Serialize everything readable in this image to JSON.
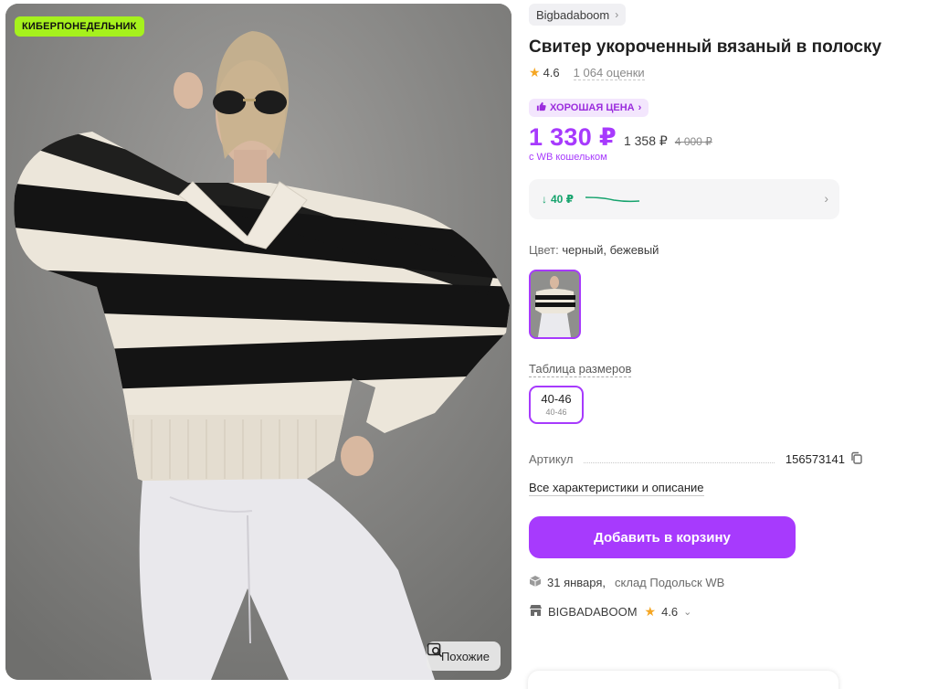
{
  "gallery": {
    "promo_badge": "КИБЕРПОНЕДЕЛЬНИК",
    "similar_label": "Похожие"
  },
  "product": {
    "brand": "Bigbadaboom",
    "title": "Свитер укороченный вязаный в полоску",
    "rating": "4.6",
    "reviews": "1 064 оценки",
    "good_price_label": "ХОРОШАЯ ЦЕНА",
    "price_main": "1 330 ₽",
    "price_mid": "1 358 ₽",
    "price_old": "4 000 ₽",
    "wallet_note": "с WB кошельком",
    "price_drop": "40 ₽",
    "color_key": "Цвет:",
    "color_value": "черный, бежевый",
    "size_table_link": "Таблица размеров",
    "sizes": [
      {
        "label": "40-46",
        "sub": "40-46"
      }
    ],
    "article_label": "Артикул",
    "article_value": "156573141",
    "all_specs_link": "Все характеристики и описание",
    "add_to_cart": "Добавить в корзину",
    "delivery_date": "31 января,",
    "warehouse": "склад Подольск WB",
    "seller_name": "BIGBADABOOM",
    "seller_rating": "4.6"
  },
  "colors": {
    "accent": "#a73afd",
    "promo": "#a6f11d",
    "price_down": "#16a36d",
    "star": "#f5a623"
  },
  "icons": [
    "search-image-icon",
    "star-icon",
    "thumbs-up-icon",
    "arrow-down-icon",
    "chevron-right-icon",
    "copy-icon",
    "box-icon",
    "shop-icon",
    "chevron-down-icon"
  ]
}
